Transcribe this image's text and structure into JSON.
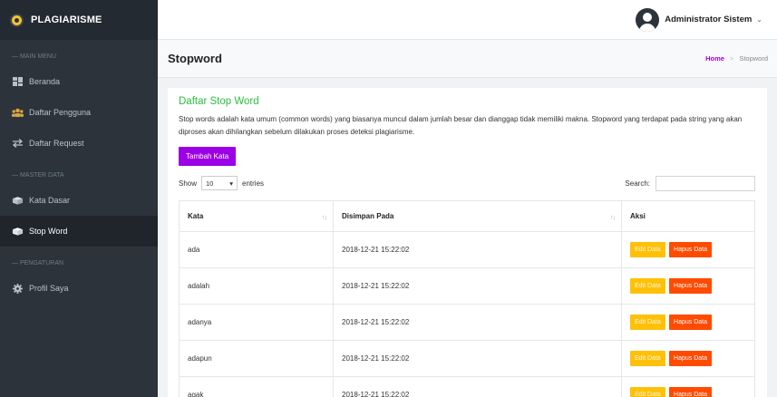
{
  "sidebar": {
    "brand": "PLAGIARISME",
    "sections": [
      "— MAIN MENU",
      "— MASTER DATA",
      "— PENGATURAN"
    ],
    "items": [
      {
        "label": "Beranda",
        "icon": "dashboard-icon"
      },
      {
        "label": "Daftar Pengguna",
        "icon": "users-icon"
      },
      {
        "label": "Daftar Request",
        "icon": "exchange-icon"
      },
      {
        "label": "Kata Dasar",
        "icon": "box-icon"
      },
      {
        "label": "Stop Word",
        "icon": "box-icon",
        "active": true
      },
      {
        "label": "Profil Saya",
        "icon": "gear-icon"
      }
    ]
  },
  "topbar": {
    "user_name": "Administrator Sistem",
    "caret": "⌄"
  },
  "page": {
    "title": "Stopword",
    "breadcrumb_home": "Home",
    "breadcrumb_sep": ">",
    "breadcrumb_current": "Stopword"
  },
  "card": {
    "title": "Daftar Stop Word",
    "description": "Stop words adalah kata umum (common words) yang biasanya muncul dalam jumlah besar dan dianggap tidak memiliki makna. Stopword yang terdapat pada string yang akan diproses akan dihilangkan sebelum dilakukan proses deteksi plagiarisme.",
    "add_button": "Tambah Kata"
  },
  "table_controls": {
    "show_label": "Show",
    "length_value": "10",
    "entries_label": "entries",
    "search_label": "Search:",
    "search_value": ""
  },
  "table": {
    "columns": [
      "Kata",
      "Disimpan Pada",
      "Aksi"
    ],
    "edit_label": "Edit Data",
    "delete_label": "Hapus Data",
    "rows": [
      {
        "kata": "ada",
        "disimpan": "2018-12-21 15:22:02"
      },
      {
        "kata": "adalah",
        "disimpan": "2018-12-21 15:22:02"
      },
      {
        "kata": "adanya",
        "disimpan": "2018-12-21 15:22:02"
      },
      {
        "kata": "adapun",
        "disimpan": "2018-12-21 15:22:02"
      },
      {
        "kata": "agak",
        "disimpan": "2018-12-21 15:22:02"
      }
    ]
  },
  "colors": {
    "sidebar_bg": "#2c333b",
    "accent": "#9b00e6",
    "title_green": "#2bbf3f",
    "edit": "#ffc107",
    "delete": "#ff4b00"
  }
}
